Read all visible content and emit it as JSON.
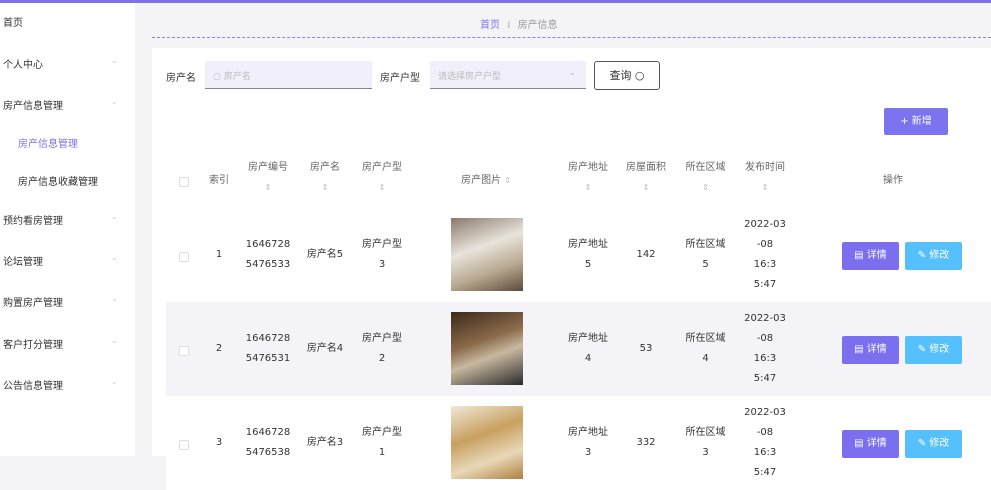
{
  "sidebar": {
    "items": [
      {
        "label": "首页"
      },
      {
        "label": "个人中心"
      },
      {
        "label": "房产信息管理"
      },
      {
        "label": "房产信息管理",
        "active": true
      },
      {
        "label": "房产信息收藏管理"
      },
      {
        "label": "预约看房管理"
      },
      {
        "label": "论坛管理"
      },
      {
        "label": "购置房产管理"
      },
      {
        "label": "客户打分管理"
      },
      {
        "label": "公告信息管理"
      }
    ]
  },
  "breadcrumb": {
    "home": "首页",
    "separator": "⁞",
    "current": "房产信息"
  },
  "search": {
    "name_label": "房产名",
    "name_placeholder": "房产名",
    "type_label": "房产户型",
    "type_placeholder": "请选择房产户型",
    "query_label": "查询 ○",
    "add_label": "+ 新增"
  },
  "table": {
    "headers": [
      "索引",
      "房产编号",
      "房产名",
      "房产户型",
      "房产图片",
      "房产地址",
      "房屋面积",
      "所在区域",
      "发布时间",
      "操作"
    ],
    "sort_icon": "⇕",
    "rows": [
      {
        "index": "1",
        "code": "1646728 5476533",
        "name": "房产名5",
        "type": "房产户型 3",
        "address": "房产地址 5",
        "area": "142",
        "region": "所在区域 5",
        "time": "2022-03 -08 16:3 5:47"
      },
      {
        "index": "2",
        "code": "1646728 5476531",
        "name": "房产名4",
        "type": "房产户型 2",
        "address": "房产地址 4",
        "area": "53",
        "region": "所在区域 4",
        "time": "2022-03 -08 16:3 5:47"
      },
      {
        "index": "3",
        "code": "1646728 5476538",
        "name": "房产名3",
        "type": "房产户型 1",
        "address": "房产地址 3",
        "area": "332",
        "region": "所在区域 3",
        "time": "2022-03 -08 16:3 5:47"
      }
    ],
    "detail_label": "▤ 详情",
    "edit_label": "✎ 修改"
  },
  "colors": {
    "accent": "#7b73f0",
    "edit": "#55c0fb"
  }
}
